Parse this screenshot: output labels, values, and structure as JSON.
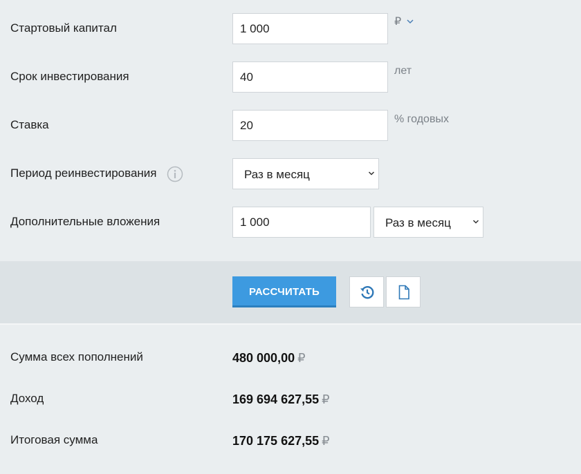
{
  "form": {
    "start_capital": {
      "label": "Стартовый капитал",
      "value": "1 000",
      "unit": "₽"
    },
    "term": {
      "label": "Срок инвестирования",
      "value": "40",
      "unit": "лет"
    },
    "rate": {
      "label": "Ставка",
      "value": "20",
      "unit": "% годовых"
    },
    "reinvest": {
      "label": "Период реинвестирования",
      "selected": "Раз в месяц"
    },
    "additional": {
      "label": "Дополнительные вложения",
      "value": "1 000",
      "period_selected": "Раз в месяц"
    }
  },
  "actions": {
    "calculate_label": "РАССЧИТАТЬ",
    "reset_icon": "history-reset-icon",
    "export_icon": "document-icon"
  },
  "results": {
    "total_contributions": {
      "label": "Сумма всех пополнений",
      "value": "480 000,00",
      "currency": "₽"
    },
    "income": {
      "label": "Доход",
      "value": "169 694 627,55",
      "currency": "₽"
    },
    "final_sum": {
      "label": "Итоговая сумма",
      "value": "170 175 627,55",
      "currency": "₽"
    }
  },
  "colors": {
    "accent": "#3d9ae0",
    "background": "#eaeef0",
    "action_bar": "#dce2e5"
  }
}
